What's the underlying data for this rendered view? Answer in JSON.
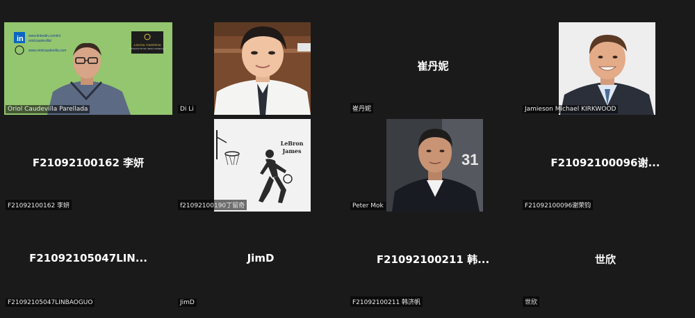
{
  "participants": [
    {
      "label": "Oriol Caudevilla Parellada",
      "center_name": "",
      "links": [
        "www.linkedin.com/in/",
        "oriolcaudevilla/",
        "www.oriolcaudevilla.com"
      ],
      "badge": [
        "A DIGITAL TOMORROW",
        "A PODCAST BY DR. ORIOL CAUDEVILLA"
      ]
    },
    {
      "label": "Di Li",
      "center_name": ""
    },
    {
      "label": "崔丹妮",
      "center_name": "崔丹妮"
    },
    {
      "label": "Jamieson Michael KIRKWOOD",
      "center_name": ""
    },
    {
      "label": "F21092100162 李妍",
      "center_name": "F21092100162 李妍"
    },
    {
      "label": "f21092100190丁留奇",
      "center_name": "",
      "wall_text": [
        "LeBron",
        "James"
      ]
    },
    {
      "label": "Peter Mok",
      "center_name": ""
    },
    {
      "label": "F21092100096谢荣钧",
      "center_name": "F21092100096谢..."
    },
    {
      "label": "F21092105047LINBAOGUO",
      "center_name": "F21092105047LIN..."
    },
    {
      "label": "JimD",
      "center_name": "JimD"
    },
    {
      "label": "F21092100211 韩济帆",
      "center_name": "F21092100211 韩..."
    },
    {
      "label": "世欣",
      "center_name": "世欣"
    }
  ],
  "colors": {
    "background": "#1a1a1a",
    "green_screen": "#93c66e",
    "text": "#ffffff"
  }
}
